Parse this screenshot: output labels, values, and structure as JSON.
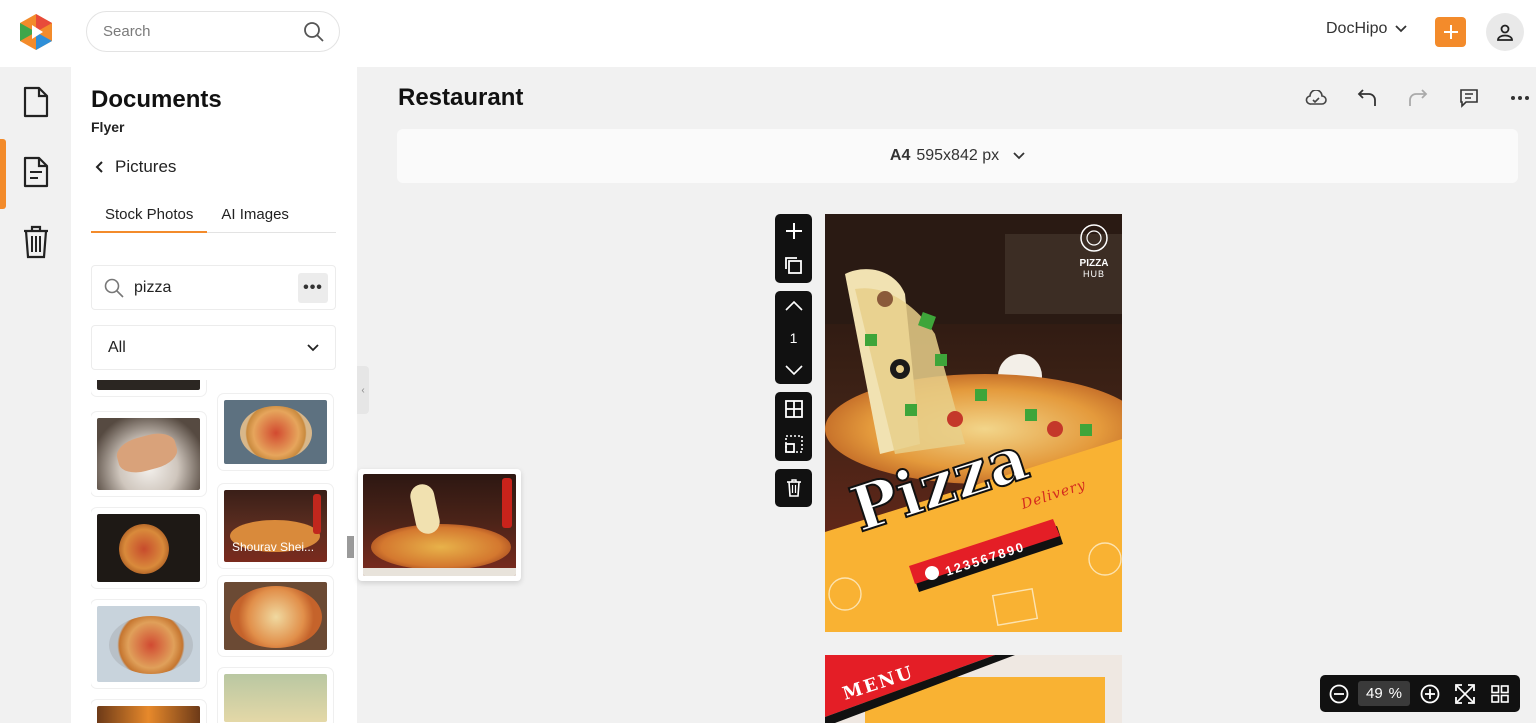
{
  "header": {
    "search_placeholder": "Search",
    "brand": "DocHipo",
    "accent_color": "#f38b2b"
  },
  "rail": {
    "items": [
      {
        "icon": "document-icon",
        "active": false
      },
      {
        "icon": "document-lines-icon",
        "active": true
      },
      {
        "icon": "trash-icon",
        "active": false
      }
    ]
  },
  "panel": {
    "title": "Documents",
    "subtitle": "Flyer",
    "back_label": "Pictures",
    "tabs": [
      "Stock Photos",
      "AI Images"
    ],
    "active_tab": "Stock Photos",
    "search_value": "pizza",
    "more_label": "•••",
    "filter_value": "All",
    "thumb_caption": "Shourav Shei..."
  },
  "main": {
    "doc_title": "Restaurant",
    "size_name": "A4",
    "size_dims": "595x842 px",
    "page_number": "1"
  },
  "flyer": {
    "brand_line1": "PIZZA",
    "brand_line2": "HUB",
    "headline": "Pizza",
    "tagline": "Delivery",
    "phone": "123567890",
    "menu_label": "MENU"
  },
  "zoom": {
    "value": "49",
    "unit": "%"
  }
}
